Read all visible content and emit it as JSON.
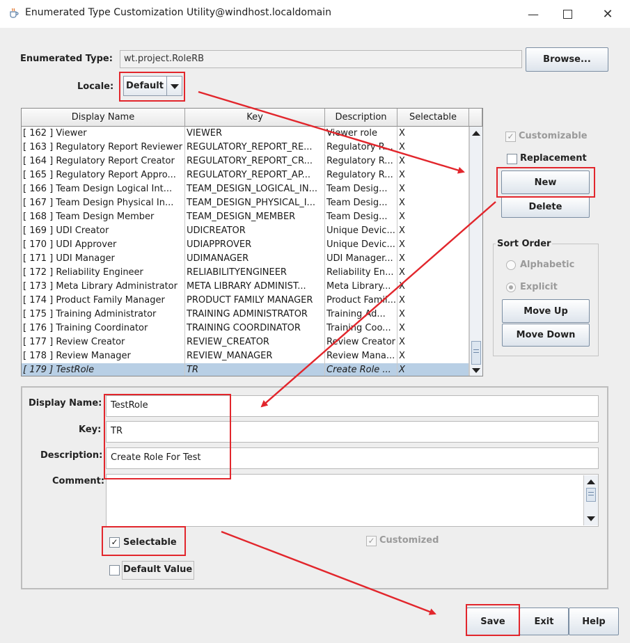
{
  "window": {
    "title": "Enumerated Type Customization Utility@windhost.localdomain",
    "controls": [
      "minimize",
      "maximize",
      "close"
    ]
  },
  "header": {
    "enum_type_label": "Enumerated Type:",
    "enum_type_value": "wt.project.RoleRB",
    "browse_label": "Browse...",
    "locale_label": "Locale:",
    "locale_value": "Default"
  },
  "table": {
    "columns": [
      "Display Name",
      "Key",
      "Description",
      "Selectable"
    ],
    "rows": [
      {
        "name": "[ 162 ]  Viewer",
        "key": "VIEWER",
        "desc": "Viewer role",
        "sel": "X"
      },
      {
        "name": "[ 163 ]  Regulatory Report Reviewer",
        "key": "REGULATORY_REPORT_RE...",
        "desc": "Regulatory R...",
        "sel": "X"
      },
      {
        "name": "[ 164 ]  Regulatory Report Creator",
        "key": "REGULATORY_REPORT_CR...",
        "desc": "Regulatory R...",
        "sel": "X"
      },
      {
        "name": "[ 165 ]  Regulatory Report Appro...",
        "key": "REGULATORY_REPORT_AP...",
        "desc": "Regulatory R...",
        "sel": "X"
      },
      {
        "name": "[ 166 ]  Team Design Logical Int...",
        "key": "TEAM_DESIGN_LOGICAL_IN...",
        "desc": "Team Desig...",
        "sel": "X"
      },
      {
        "name": "[ 167 ]  Team Design Physical In...",
        "key": "TEAM_DESIGN_PHYSICAL_I...",
        "desc": "Team Desig...",
        "sel": "X"
      },
      {
        "name": "[ 168 ]  Team Design Member",
        "key": "TEAM_DESIGN_MEMBER",
        "desc": "Team Desig...",
        "sel": "X"
      },
      {
        "name": "[ 169 ]  UDI Creator",
        "key": "UDICREATOR",
        "desc": "Unique Devic...",
        "sel": "X"
      },
      {
        "name": "[ 170 ]  UDI Approver",
        "key": "UDIAPPROVER",
        "desc": "Unique Devic...",
        "sel": "X"
      },
      {
        "name": "[ 171 ]  UDI Manager",
        "key": "UDIMANAGER",
        "desc": "UDI Manager...",
        "sel": "X"
      },
      {
        "name": "[ 172 ]  Reliability Engineer",
        "key": "RELIABILITYENGINEER",
        "desc": "Reliability En...",
        "sel": "X"
      },
      {
        "name": "[ 173 ]  Meta Library Administrator",
        "key": "META LIBRARY ADMINIST...",
        "desc": "Meta Library...",
        "sel": "X"
      },
      {
        "name": "[ 174 ]  Product Family Manager",
        "key": "PRODUCT FAMILY MANAGER",
        "desc": "Product Famil...",
        "sel": "X"
      },
      {
        "name": "[ 175 ]  Training Administrator",
        "key": "TRAINING ADMINISTRATOR",
        "desc": "Training Ad...",
        "sel": "X"
      },
      {
        "name": "[ 176 ]  Training Coordinator",
        "key": "TRAINING COORDINATOR",
        "desc": "Training Coo...",
        "sel": "X"
      },
      {
        "name": "[ 177 ]  Review Creator",
        "key": "REVIEW_CREATOR",
        "desc": "Review Creator",
        "sel": "X"
      },
      {
        "name": "[ 178 ]  Review Manager",
        "key": "REVIEW_MANAGER",
        "desc": "Review Mana...",
        "sel": "X"
      },
      {
        "name": "[ 179 ]  TestRole",
        "key": "TR",
        "desc": "Create Role ...",
        "sel": "X",
        "selected": true
      }
    ]
  },
  "side": {
    "customizable_label": "Customizable",
    "replacement_label": "Replacement",
    "new_label": "New",
    "delete_label": "Delete",
    "sort_order_label": "Sort Order",
    "alphabetic_label": "Alphabetic",
    "explicit_label": "Explicit",
    "move_up_label": "Move Up",
    "move_down_label": "Move Down"
  },
  "details": {
    "display_name_label": "Display Name:",
    "display_name_value": "TestRole",
    "key_label": "Key:",
    "key_value": "TR",
    "description_label": "Description:",
    "description_value": "Create Role For Test",
    "comment_label": "Comment:",
    "comment_value": "",
    "selectable_label": "Selectable",
    "selectable_checked": true,
    "customized_label": "Customized",
    "default_value_label": "Default Value",
    "default_value_checked": false
  },
  "footer": {
    "save_label": "Save",
    "exit_label": "Exit",
    "help_label": "Help"
  },
  "colors": {
    "annotation": "#e2262c",
    "selected_row": "#b8cfe5",
    "window_bg": "#eeeeee"
  }
}
